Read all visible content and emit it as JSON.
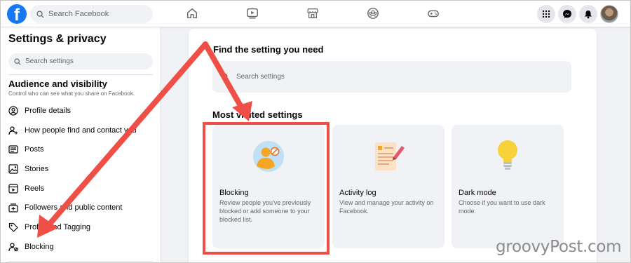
{
  "topbar": {
    "logo_letter": "f",
    "search_placeholder": "Search Facebook",
    "nav_icons": [
      "home-icon",
      "watch-icon",
      "marketplace-icon",
      "groups-icon",
      "gaming-icon"
    ],
    "right_icons": [
      "menu-grid-icon",
      "messenger-icon",
      "notifications-icon",
      "account-avatar"
    ]
  },
  "sidebar": {
    "title": "Settings & privacy",
    "search_placeholder": "Search settings",
    "section_title": "Audience and visibility",
    "section_subtitle": "Control who can see what you share on Facebook.",
    "items": [
      {
        "label": "Profile details",
        "icon": "profile-icon"
      },
      {
        "label": "How people find and contact you",
        "icon": "person-add-icon"
      },
      {
        "label": "Posts",
        "icon": "posts-icon"
      },
      {
        "label": "Stories",
        "icon": "stories-icon"
      },
      {
        "label": "Reels",
        "icon": "reels-icon"
      },
      {
        "label": "Followers and public content",
        "icon": "followers-icon"
      },
      {
        "label": "Profile and Tagging",
        "icon": "tag-icon"
      },
      {
        "label": "Blocking",
        "icon": "blocking-icon"
      }
    ]
  },
  "main": {
    "find_title": "Find the setting you need",
    "search_placeholder": "Search settings",
    "most_visited_title": "Most visited settings",
    "tiles": [
      {
        "title": "Blocking",
        "description": "Review people you've previously blocked or add someone to your blocked list.",
        "icon": "blocking-illustration"
      },
      {
        "title": "Activity log",
        "description": "View and manage your activity on Facebook.",
        "icon": "activity-log-illustration"
      },
      {
        "title": "Dark mode",
        "description": "Choose if you want to use dark mode.",
        "icon": "lightbulb-illustration"
      }
    ]
  },
  "colors": {
    "brand": "#1877f2",
    "annotation": "#ef4f47",
    "background": "#f0f2f5"
  },
  "watermark": "groovyPost.com"
}
